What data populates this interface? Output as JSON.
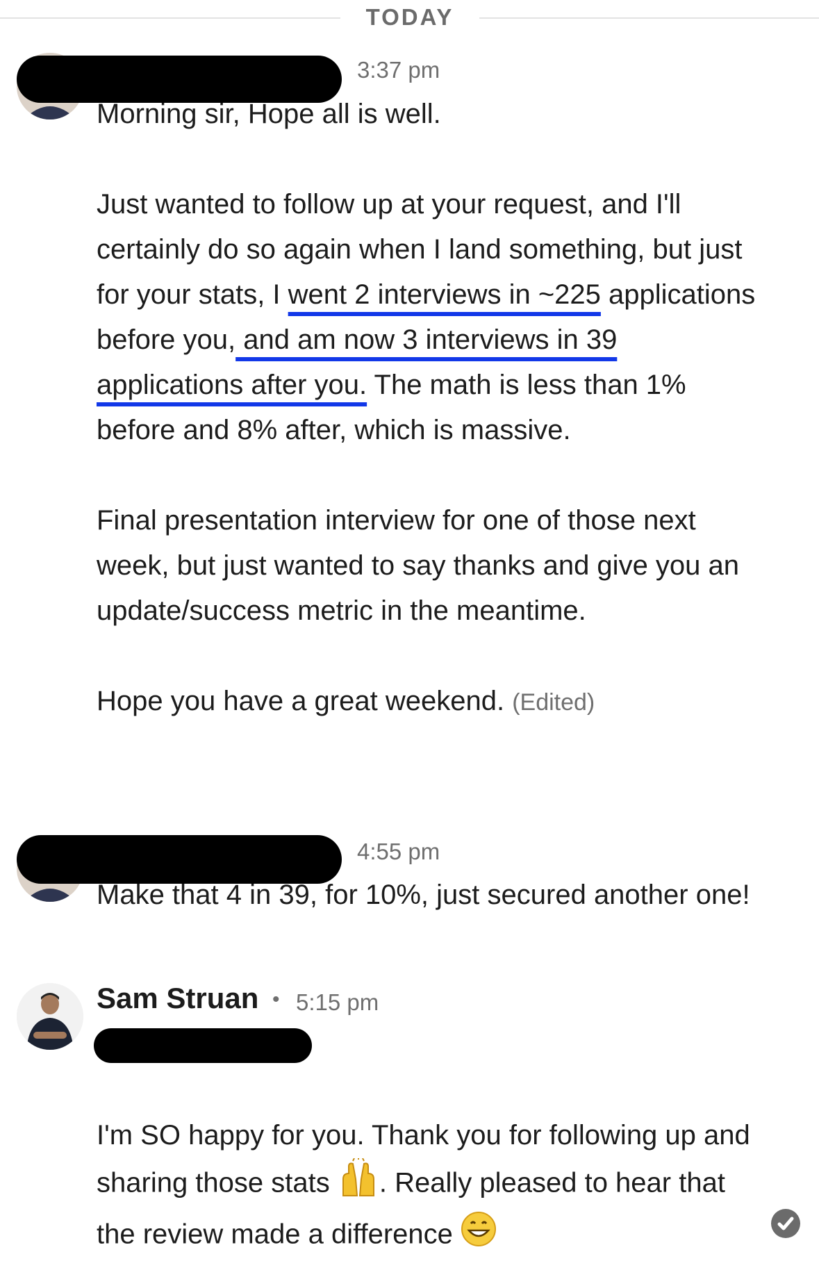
{
  "divider": {
    "label": "TODAY"
  },
  "messages": [
    {
      "time": "3:37 pm",
      "paragraphs": {
        "p1": "Morning sir, Hope all is well.",
        "p2": {
          "a": "Just wanted to follow up at your request, and I'll certainly do so again when I land something, but just for your stats, I ",
          "u1": "went 2 interviews in ~225",
          "b": " applications before you,",
          "u2": " and am now 3 interviews in 39 applications after you.",
          "c": " The math is less than 1% before and 8% after, which is massive."
        },
        "p3": "Final presentation interview for one of those next week, but just wanted to say thanks and give you an update/success metric in the meantime.",
        "p4": "Hope you have a great weekend.",
        "edited": "(Edited)"
      }
    },
    {
      "time": "4:55 pm",
      "text": "Make that 4 in 39, for 10%, just secured another one!"
    },
    {
      "sender": "Sam Struan",
      "separator": "•",
      "time": "5:15 pm",
      "text_a": "I'm SO happy for you. Thank you for following up and sharing those stats ",
      "emoji1": "raising-hands-emoji",
      "text_b": ". Really pleased to hear that the review made a difference ",
      "emoji2": "grinning-face-emoji"
    }
  ],
  "status": {
    "icon": "read-check-icon"
  },
  "colors": {
    "underline": "#1238e8",
    "redaction": "#000000"
  }
}
